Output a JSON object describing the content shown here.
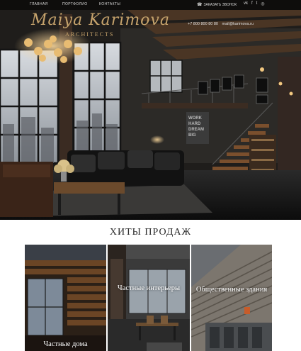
{
  "nav": {
    "items": [
      {
        "label": "ГЛАВНАЯ"
      },
      {
        "label": "ПОРТФОЛИО"
      },
      {
        "label": "КОНТАКТЫ"
      }
    ],
    "callback_label": "ЗАКАЗАТЬ ЗВОНОК",
    "socials": [
      {
        "icon": "vk-icon",
        "glyph": "vk"
      },
      {
        "icon": "facebook-icon",
        "glyph": "f"
      },
      {
        "icon": "twitter-icon",
        "glyph": "t"
      },
      {
        "icon": "instagram-icon",
        "glyph": "◎"
      }
    ]
  },
  "logo": {
    "name": "Maiya Karimova",
    "subtitle": "ARCHITECTS"
  },
  "contact": {
    "phone": "+7 800 800 80 80",
    "email": "mail@karimova.ru"
  },
  "section": {
    "title": "ХИТЫ ПРОДАЖ"
  },
  "tiles": [
    {
      "label": "Частные дома"
    },
    {
      "label": "Частные интерьеры"
    },
    {
      "label": "Общественные здания"
    }
  ],
  "colors": {
    "accent_gold": "#c6a36c",
    "hero_dark": "#161616",
    "title_text": "#2a2a2a"
  }
}
